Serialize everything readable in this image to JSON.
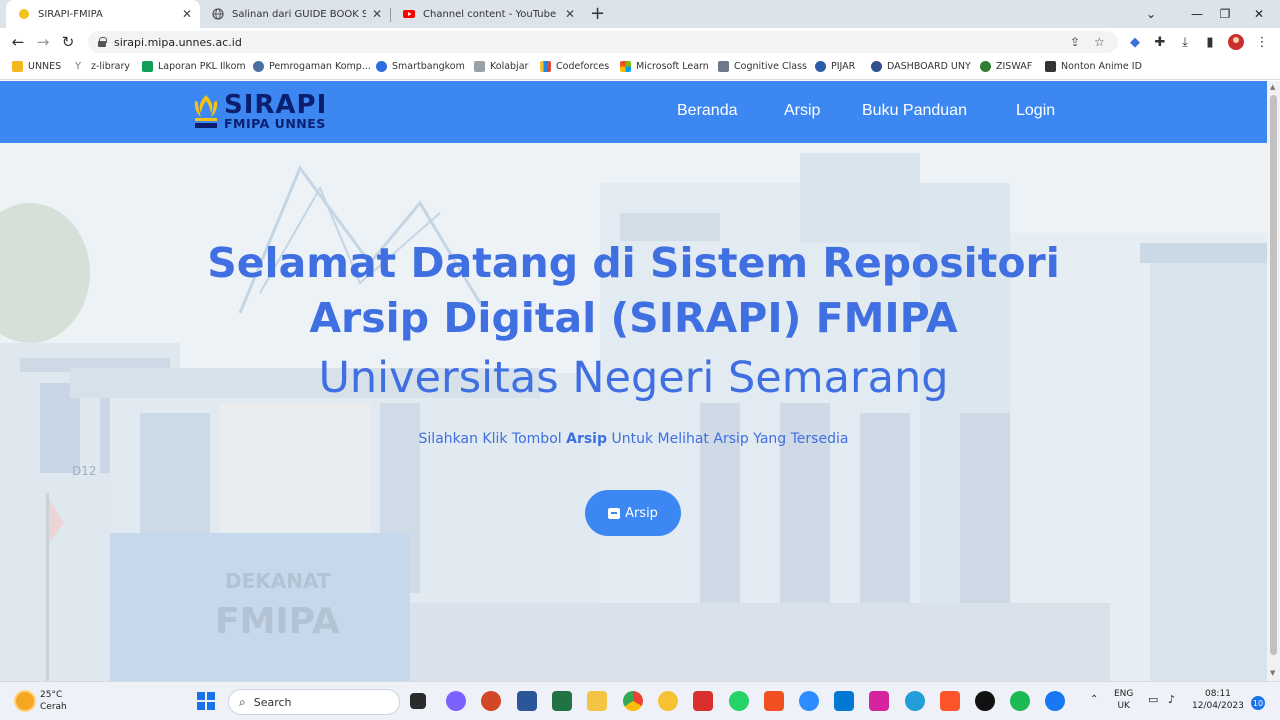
{
  "browser": {
    "tabs": [
      {
        "title": "SIRAPI-FMIPA",
        "active": true
      },
      {
        "title": "Salinan dari GUIDE BOOK SIRAPI",
        "active": false
      },
      {
        "title": "Channel content - YouTube Studi",
        "active": false
      }
    ],
    "url": "sirapi.mipa.unnes.ac.id",
    "bookmarks": [
      {
        "label": "UNNES",
        "color": "#f2b81d"
      },
      {
        "label": "z-library",
        "color": "#8a8a8a"
      },
      {
        "label": "Laporan PKL Ilkom",
        "color": "#0f9d58"
      },
      {
        "label": "Pemrogaman Komp...",
        "color": "#4a6fa5"
      },
      {
        "label": "Smartbangkom",
        "color": "#2d6cdf"
      },
      {
        "label": "Kolabjar",
        "color": "#9aa0a6"
      },
      {
        "label": "Codeforces",
        "color": "#e0493b"
      },
      {
        "label": "Microsoft Learn",
        "color": "#f25022"
      },
      {
        "label": "Cognitive Class",
        "color": "#6e7a8a"
      },
      {
        "label": "PIJAR",
        "color": "#2b5aa8"
      },
      {
        "label": "DASHBOARD UNY",
        "color": "#2f4f8f"
      },
      {
        "label": "ZISWAF",
        "color": "#2e7d32"
      },
      {
        "label": "Nonton Anime ID",
        "color": "#333333"
      }
    ]
  },
  "site": {
    "logo": {
      "title": "SIRAPI",
      "subtitle": "FMIPA UNNES"
    },
    "nav": [
      {
        "label": "Beranda"
      },
      {
        "label": "Arsip"
      },
      {
        "label": "Buku Panduan"
      },
      {
        "label": "Login"
      }
    ],
    "hero": {
      "title_line1": "Selamat Datang di Sistem Repositori",
      "title_line2": "Arsip Digital (SIRAPI) FMIPA",
      "university": "Universitas Negeri Semarang",
      "instruction_pre": "Silahkan Klik Tombol",
      "instruction_bold": "Arsip",
      "instruction_post": "Untuk Melihat Arsip Yang Tersedia",
      "button_label": "Arsip"
    },
    "colors": {
      "navbar": "#3c87f2",
      "heading": "#3f6fe0",
      "logo_text": "#0b1f6e"
    }
  },
  "taskbar": {
    "weather_temp": "25°C",
    "weather_desc": "Cerah",
    "search_placeholder": "Search",
    "language_top": "ENG",
    "language_bottom": "UK",
    "time": "08:11",
    "date": "12/04/2023",
    "notification_count": "10"
  }
}
